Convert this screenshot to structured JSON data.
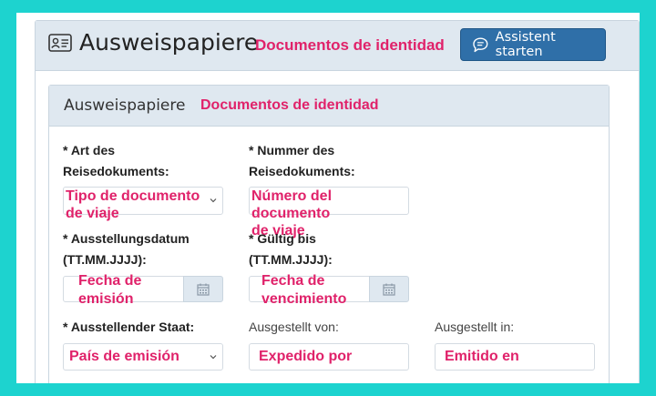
{
  "header": {
    "title": "Ausweispapiere",
    "title_es": "Documentos de identidad",
    "assistant_button": "Assistent starten"
  },
  "section": {
    "title": "Ausweispapiere",
    "title_es": "Documentos de identidad"
  },
  "fields": {
    "doc_type": {
      "label_line1": "* Art des",
      "label_line2": "Reisedokuments:",
      "placeholder_line1": "Tipo de documento",
      "placeholder_line2": "de viaje"
    },
    "doc_number": {
      "label_line1": "* Nummer des",
      "label_line2": "Reisedokuments:",
      "placeholder_line1": "Número del documento",
      "placeholder_line2": "de viaje"
    },
    "issue_date": {
      "label_line1": "* Ausstellungsdatum",
      "label_line2": "(TT.MM.JJJJ):",
      "placeholder_line1": "Fecha de",
      "placeholder_line2": "emisión"
    },
    "valid_until": {
      "label_line1": "* Gültig bis",
      "label_line2": "(TT.MM.JJJJ):",
      "placeholder_line1": "Fecha de",
      "placeholder_line2": "vencimiento"
    },
    "issuing_state": {
      "label": "* Ausstellender Staat:",
      "placeholder": "País de emisión"
    },
    "issued_by": {
      "label": "Ausgestellt von:",
      "placeholder": "Expedido por"
    },
    "issued_in": {
      "label": "Ausgestellt in:",
      "placeholder": "Emitido en"
    }
  },
  "colors": {
    "background": "#1dd3cf",
    "header_bg": "#dfe8f0",
    "button_bg": "#2f6fa8",
    "annotation": "#e0226a"
  }
}
